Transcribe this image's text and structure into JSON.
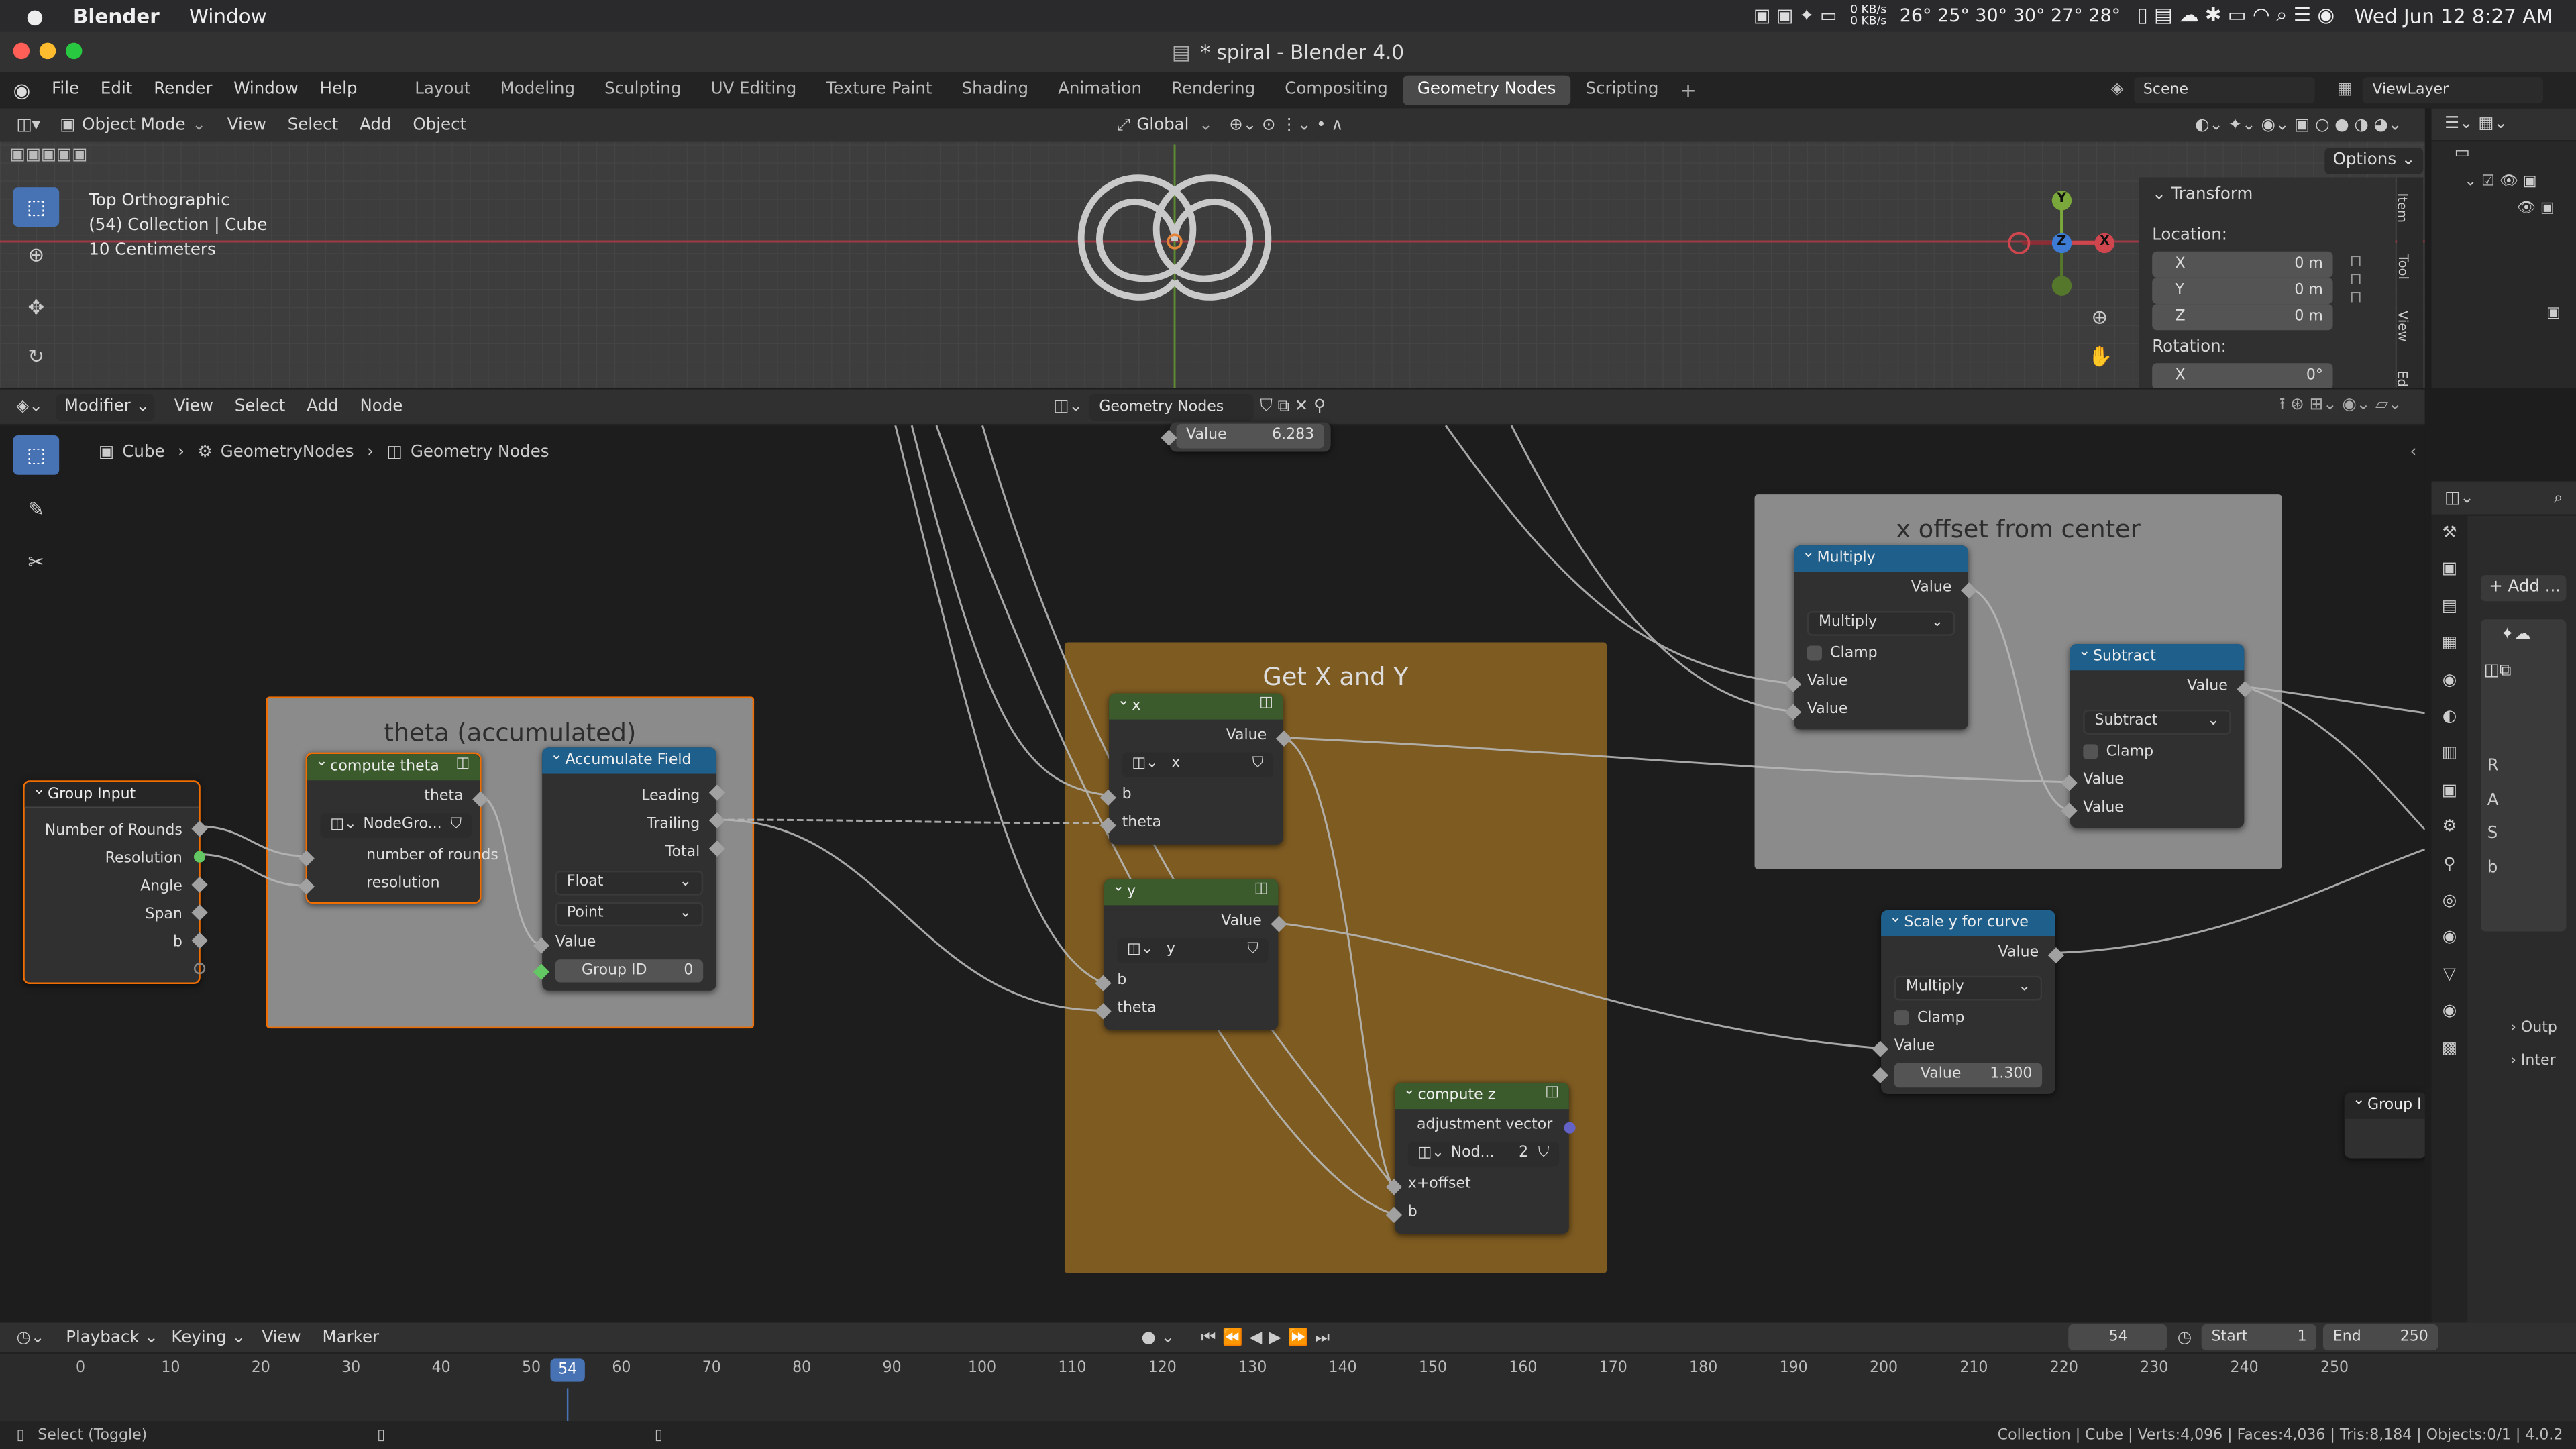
{
  "macbar": {
    "apple": "",
    "app": "Blender",
    "window_menu": "Window",
    "net_up": "0 KB/s",
    "net_down": "0 KB/s",
    "temps": "26° 25° 30° 30° 27° 28°",
    "datetime": "Wed Jun 12  8:27 AM"
  },
  "title": "* spiral - Blender 4.0",
  "menus": [
    "File",
    "Edit",
    "Render",
    "Window",
    "Help"
  ],
  "workspaces": [
    "Layout",
    "Modeling",
    "Sculpting",
    "UV Editing",
    "Texture Paint",
    "Shading",
    "Animation",
    "Rendering",
    "Compositing",
    "Geometry Nodes",
    "Scripting"
  ],
  "active_workspace": "Geometry Nodes",
  "scene": "Scene",
  "viewlayer": "ViewLayer",
  "viewport": {
    "mode": "Object Mode",
    "menus": [
      "View",
      "Select",
      "Add",
      "Object"
    ],
    "orient": "Global",
    "options": "Options",
    "info1": "Top Orthographic",
    "info2": "(54) Collection | Cube",
    "info3": "10 Centimeters",
    "gizmo": {
      "y": "Y",
      "z": "Z",
      "x": "X"
    }
  },
  "npanel": {
    "transform": "Transform",
    "location": "Location:",
    "loc": [
      [
        "X",
        "0 m"
      ],
      [
        "Y",
        "0 m"
      ],
      [
        "Z",
        "0 m"
      ]
    ],
    "rotation": "Rotation:",
    "rot": [
      [
        "X",
        "0°"
      ]
    ],
    "tabs": [
      "Item",
      "Tool",
      "View",
      "Ed"
    ]
  },
  "node_editor": {
    "type": "Modifier",
    "menus": [
      "View",
      "Select",
      "Add",
      "Node"
    ],
    "tree": "Geometry Nodes",
    "crumbs": [
      "Cube",
      "GeometryNodes",
      "Geometry Nodes"
    ]
  },
  "frames": {
    "theta": "theta (accumulated)",
    "getxy": "Get X and Y",
    "xoff": "x offset from center"
  },
  "nodes": {
    "value_top": {
      "label": "Value",
      "value": "6.283"
    },
    "group_input": {
      "title": "Group Input",
      "outs": [
        "Number of Rounds",
        "Resolution",
        "Angle",
        "Span",
        "b"
      ]
    },
    "compute_theta": {
      "title": "compute theta",
      "out": "theta",
      "group": "NodeGro...",
      "ins": [
        "number of rounds",
        "resolution"
      ]
    },
    "accumulate": {
      "title": "Accumulate Field",
      "outs": [
        "Leading",
        "Trailing",
        "Total"
      ],
      "type": "Float",
      "domain": "Point",
      "in": "Value",
      "gid_label": "Group ID",
      "gid_val": "0"
    },
    "x": {
      "title": "x",
      "out": "Value",
      "group": "x",
      "ins": [
        "b",
        "theta"
      ]
    },
    "y": {
      "title": "y",
      "out": "Value",
      "group": "y",
      "ins": [
        "b",
        "theta"
      ]
    },
    "compute_z": {
      "title": "compute z",
      "out": "adjustment vector",
      "group": "Nod...",
      "users": "2",
      "ins": [
        "x+offset",
        "b"
      ]
    },
    "multiply": {
      "title": "Multiply",
      "out": "Value",
      "op": "Multiply",
      "clamp": "Clamp",
      "ins": [
        "Value",
        "Value"
      ]
    },
    "subtract": {
      "title": "Subtract",
      "out": "Value",
      "op": "Subtract",
      "clamp": "Clamp",
      "ins": [
        "Value",
        "Value"
      ]
    },
    "scale_y": {
      "title": "Scale y for curve",
      "out": "Value",
      "op": "Multiply",
      "clamp": "Clamp",
      "in": "Value",
      "val_label": "Value",
      "val": "1.300"
    },
    "group_out": {
      "title": "Group I"
    }
  },
  "props": {
    "add": "Add ...",
    "items": [
      "Outp",
      "Inter"
    ],
    "letters": [
      "R",
      "A",
      "S",
      "b"
    ]
  },
  "timeline": {
    "menus": [
      "Playback",
      "Keying",
      "View",
      "Marker"
    ],
    "frame": "54",
    "start_label": "Start",
    "start": "1",
    "end_label": "End",
    "end": "250",
    "ticks": [
      "0",
      "10",
      "20",
      "30",
      "40",
      "50",
      "54",
      "60",
      "70",
      "80",
      "90",
      "100",
      "110",
      "120",
      "130",
      "140",
      "150",
      "160",
      "170",
      "180",
      "190",
      "200",
      "210",
      "220",
      "230",
      "240",
      "250"
    ]
  },
  "status": {
    "left": "Select (Toggle)",
    "right": "Collection | Cube | Verts:4,096 | Faces:4,036 | Tris:8,184 | Objects:0/1 | 4.0.2"
  }
}
